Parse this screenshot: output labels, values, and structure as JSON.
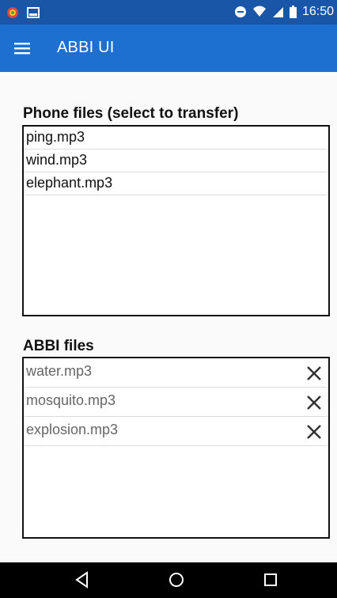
{
  "status_bar": {
    "time": "16:50",
    "left_icons": [
      "android-debug-icon",
      "image-notification-icon"
    ],
    "right_icons": [
      "do-not-disturb-icon",
      "wifi-icon",
      "cell-signal-icon",
      "battery-icon"
    ]
  },
  "app_bar": {
    "menu_icon": "hamburger-menu-icon",
    "title": "ABBI UI"
  },
  "phone_files": {
    "heading": "Phone files (select to transfer)",
    "items": [
      "ping.mp3",
      "wind.mp3",
      "elephant.mp3"
    ]
  },
  "abbi_files": {
    "heading": "ABBI files",
    "items": [
      "water.mp3",
      "mosquito.mp3",
      "explosion.mp3"
    ],
    "delete_icon": "close-icon"
  },
  "nav_bar": {
    "icons": [
      "back-triangle-icon",
      "home-circle-icon",
      "recents-square-icon"
    ]
  },
  "colors": {
    "status_bar": "#1a56a8",
    "app_bar": "#1d6fd0",
    "content_bg": "#fafafa",
    "nav_bar": "#000000"
  }
}
